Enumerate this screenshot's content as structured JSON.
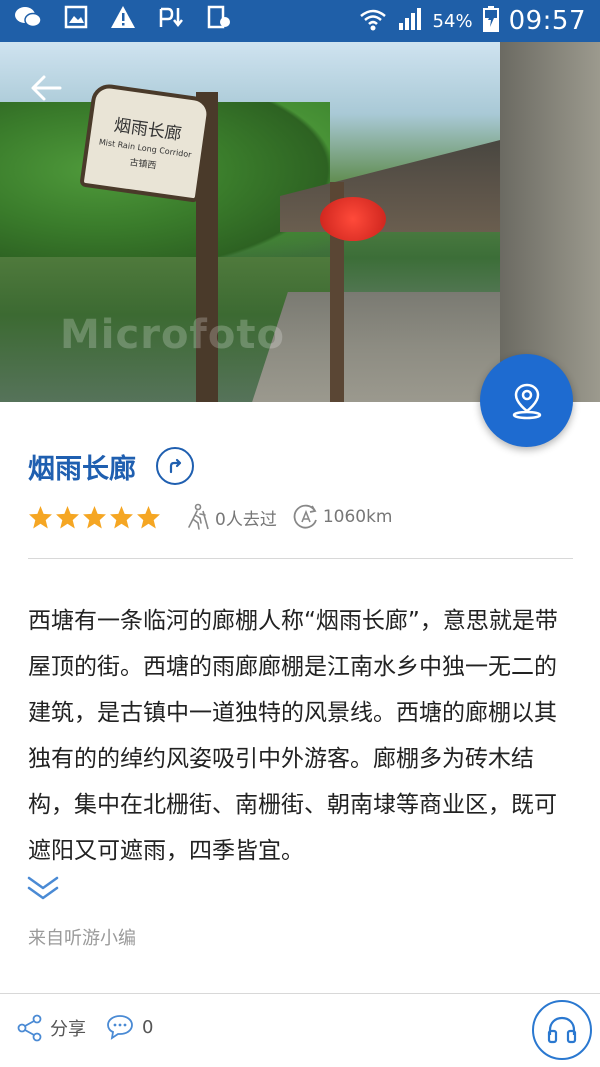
{
  "status_bar": {
    "battery_percent": "54%",
    "time": "09:57",
    "icons": [
      "wechat-icon",
      "image-icon",
      "warning-icon",
      "download-icon",
      "clipboard-icon",
      "wifi-icon",
      "signal-icon",
      "battery-icon"
    ]
  },
  "hero": {
    "sign_chinese": "烟雨长廊",
    "sign_english": "Mist Rain Long Corridor",
    "sign_small": "古镇西",
    "watermark": "Microfoto"
  },
  "place": {
    "name": "烟雨长廊",
    "rating": 5,
    "visited": "0人去过",
    "distance": "1060km"
  },
  "description": "西塘有一条临河的廊棚人称“烟雨长廊”，意思就是带屋顶的街。西塘的雨廊廊棚是江南水乡中独一无二的建筑，是古镇中一道独特的风景线。西塘的廊棚以其独有的的绰约风姿吸引中外游客。廊棚多为砖木结构，集中在北栅街、南栅街、朝南埭等商业区，既可遮阳又可遮雨，四季皆宜。",
  "source": "来自听游小编",
  "bottom_bar": {
    "share_label": "分享",
    "comment_count": "0"
  },
  "colors": {
    "status_bar": "#1f5fa8",
    "accent": "#1f5fb0",
    "fab": "#1e6bd0",
    "star": "#f5a623"
  }
}
